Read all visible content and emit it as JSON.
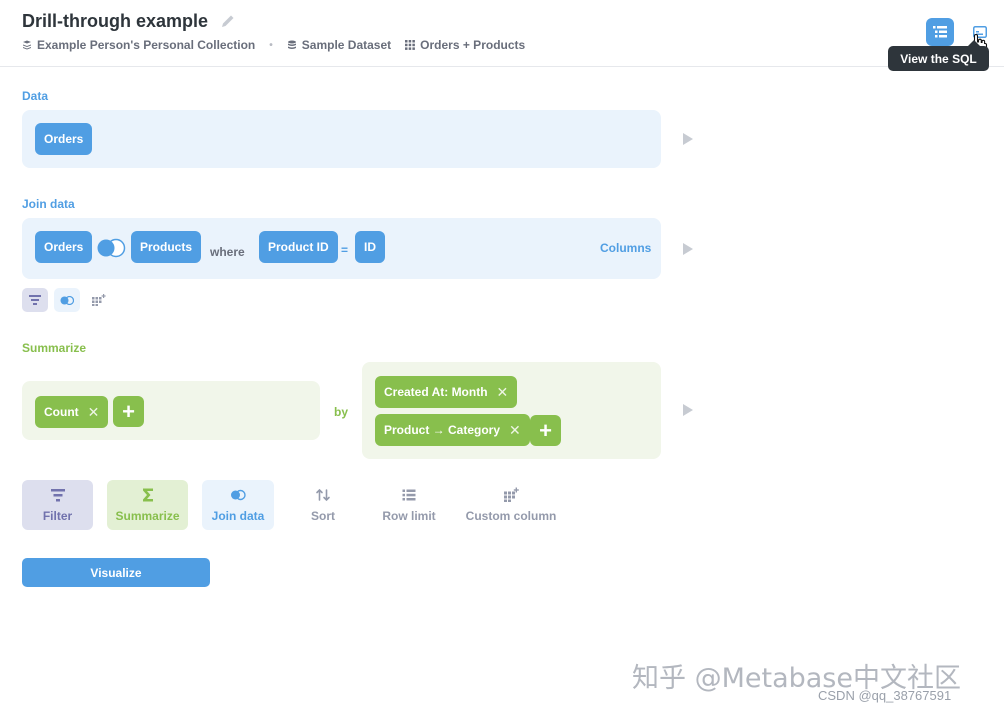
{
  "header": {
    "title": "Drill-through example",
    "breadcrumbs": [
      {
        "label": "Example Person's Personal Collection",
        "icon": "collection-icon"
      },
      {
        "label": "Sample Dataset",
        "icon": "database-icon"
      },
      {
        "label": "Orders + Products",
        "icon": "table-icon"
      }
    ],
    "tooltip": "View the SQL"
  },
  "data_step": {
    "label": "Data",
    "table": "Orders"
  },
  "join_step": {
    "label": "Join data",
    "left_table": "Orders",
    "right_table": "Products",
    "where_label": "where",
    "left_column": "Product ID",
    "operator": "=",
    "right_column": "ID",
    "columns_label": "Columns"
  },
  "summarize_step": {
    "label": "Summarize",
    "metrics": [
      {
        "label": "Count"
      }
    ],
    "by_label": "by",
    "breakouts": [
      {
        "label": "Created At: Month"
      },
      {
        "label": "Product → Category"
      }
    ]
  },
  "actions": {
    "filter": "Filter",
    "summarize": "Summarize",
    "join": "Join data",
    "sort": "Sort",
    "row_limit": "Row limit",
    "custom_column": "Custom column"
  },
  "visualize_label": "Visualize",
  "watermark": {
    "main": "知乎 @Metabase中文社区",
    "small": "CSDN @qq_38767591"
  },
  "colors": {
    "brand_blue": "#509ee3",
    "summarize_green": "#88bf4d",
    "filter_purple": "#7172ad"
  }
}
